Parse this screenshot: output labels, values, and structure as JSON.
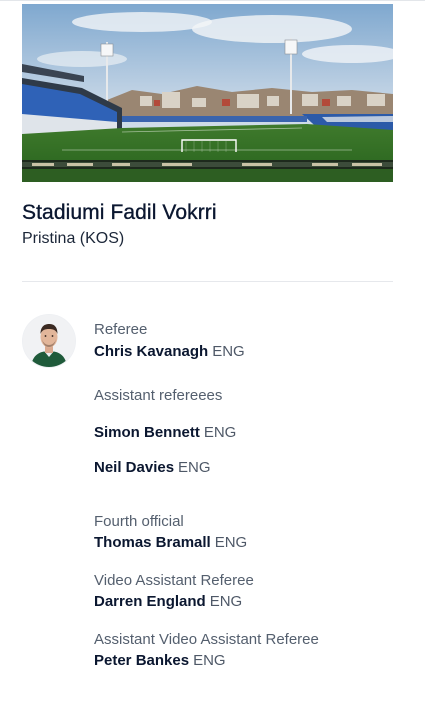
{
  "venue": {
    "name": "Stadiumi Fadil Vokrri",
    "city": "Pristina (KOS)"
  },
  "officials": {
    "referee": {
      "role": "Referee",
      "name": "Chris Kavanagh",
      "nat": "ENG"
    },
    "assistants": {
      "role": "Assistant refereees",
      "list": [
        {
          "name": "Simon Bennett",
          "nat": "ENG"
        },
        {
          "name": "Neil Davies",
          "nat": "ENG"
        }
      ]
    },
    "fourth": {
      "role": "Fourth official",
      "name": "Thomas Bramall",
      "nat": "ENG"
    },
    "var": {
      "role": "Video Assistant Referee",
      "name": "Darren England",
      "nat": "ENG"
    },
    "avar": {
      "role": "Assistant Video Assistant Referee",
      "name": "Peter Bankes",
      "nat": "ENG"
    }
  }
}
